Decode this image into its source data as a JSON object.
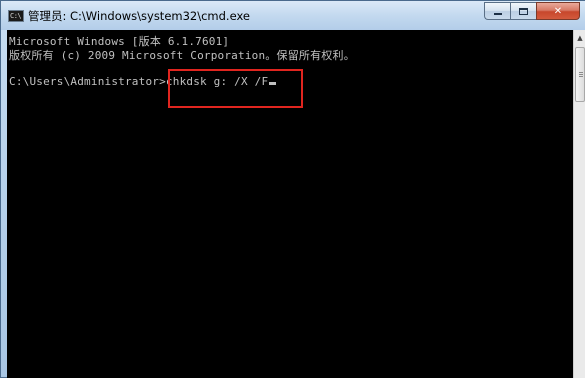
{
  "window": {
    "title": "管理员: C:\\Windows\\system32\\cmd.exe",
    "icon_text": "C:\\"
  },
  "controls": {
    "close_glyph": "✕"
  },
  "console": {
    "lines": [
      "Microsoft Windows [版本 6.1.7601]",
      "版权所有 (c) 2009 Microsoft Corporation。保留所有权利。",
      ""
    ],
    "prompt": "C:\\Users\\Administrator>",
    "command": "chkdsk g: /X /F"
  },
  "scrollbar": {
    "up_glyph": "▲"
  },
  "colors": {
    "console_bg": "#000000",
    "console_text": "#c0c0c0",
    "highlight": "#e0251f"
  }
}
